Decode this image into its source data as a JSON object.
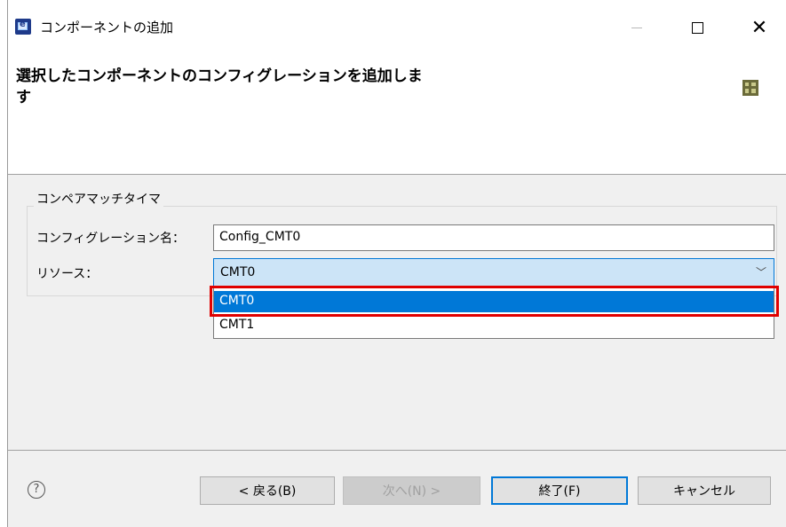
{
  "window": {
    "title": "コンポーネントの追加"
  },
  "header": {
    "title": "選択したコンポーネントのコンフィグレーションを追加します"
  },
  "group": {
    "label": "コンペアマッチタイマ",
    "config_label": "コンフィグレーション名：",
    "config_value": "Config_CMT0",
    "resource_label": "リソース：",
    "resource_selected": "CMT0",
    "options": [
      "CMT0",
      "CMT1"
    ]
  },
  "footer": {
    "help_glyph": "?",
    "back_label": "< 戻る(B)",
    "next_label": "次へ(N) >",
    "finish_label": "終了(F)",
    "cancel_label": "キャンセル"
  },
  "colors": {
    "selection_blue": "#0078d7",
    "highlight_red": "#e00000",
    "combo_bg": "#cce4f7"
  }
}
